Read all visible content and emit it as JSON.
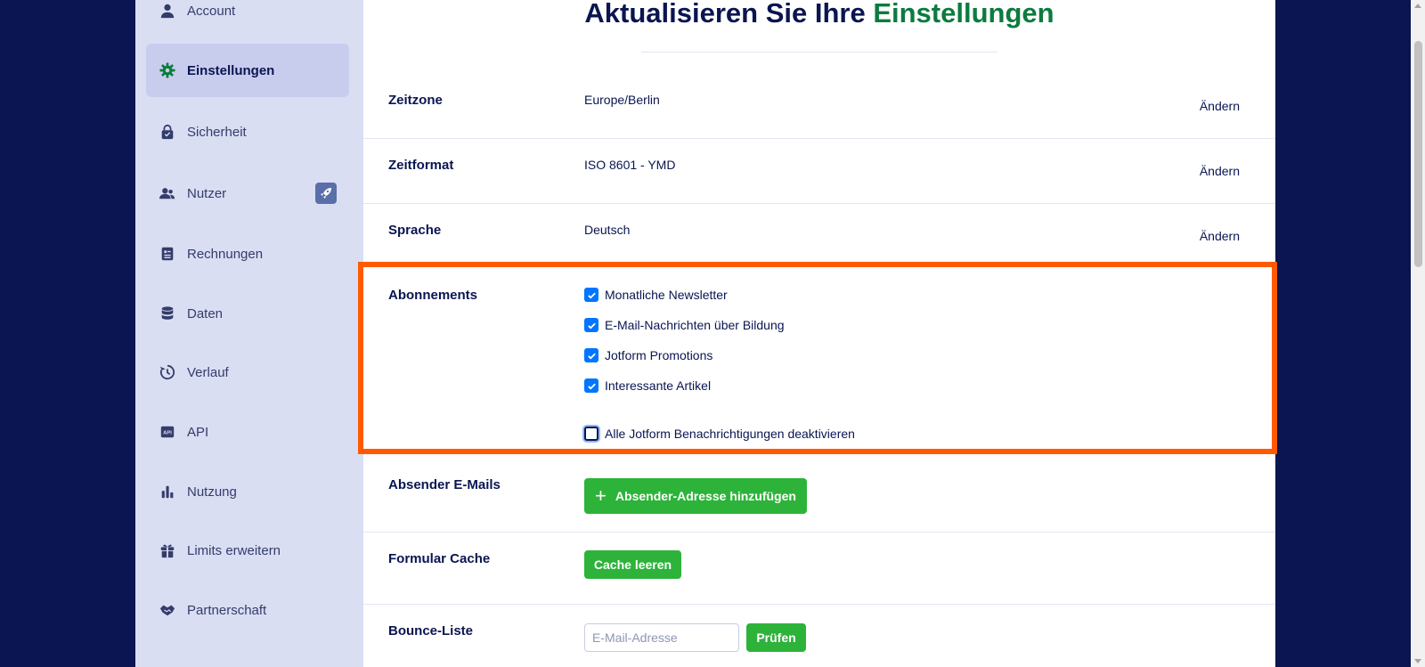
{
  "sidebar": {
    "items": [
      {
        "label": "Account",
        "icon": "user-icon"
      },
      {
        "label": "Einstellungen",
        "icon": "gear-icon",
        "active": true
      },
      {
        "label": "Sicherheit",
        "icon": "lock-icon"
      },
      {
        "label": "Nutzer",
        "icon": "users-icon",
        "badge_icon": "rocket-icon"
      },
      {
        "label": "Rechnungen",
        "icon": "invoice-icon"
      },
      {
        "label": "Daten",
        "icon": "database-icon"
      },
      {
        "label": "Verlauf",
        "icon": "history-icon"
      },
      {
        "label": "API",
        "icon": "api-icon"
      },
      {
        "label": "Nutzung",
        "icon": "bar-chart-icon"
      },
      {
        "label": "Limits erweitern",
        "icon": "gift-icon"
      },
      {
        "label": "Partnerschaft",
        "icon": "handshake-icon"
      }
    ]
  },
  "main": {
    "title_prefix": "Aktualisieren Sie Ihre ",
    "title_accent": "Einstellungen",
    "settings": [
      {
        "label": "Zeitzone",
        "value": "Europe/Berlin",
        "action": "Ändern"
      },
      {
        "label": "Zeitformat",
        "value": "ISO 8601 - YMD",
        "action": "Ändern"
      },
      {
        "label": "Sprache",
        "value": "Deutsch",
        "action": "Ändern"
      }
    ],
    "subscriptions": {
      "label": "Abonnements",
      "options": [
        {
          "label": "Monatliche Newsletter",
          "checked": true
        },
        {
          "label": "E-Mail-Nachrichten über Bildung",
          "checked": true
        },
        {
          "label": "Jotform Promotions",
          "checked": true
        },
        {
          "label": "Interessante Artikel",
          "checked": true
        }
      ],
      "disable_all": {
        "label": "Alle Jotform Benachrichtigungen deaktivieren",
        "checked": false
      }
    },
    "sender_emails": {
      "label": "Absender E-Mails",
      "button": "Absender-Adresse hinzufügen"
    },
    "form_cache": {
      "label": "Formular Cache",
      "button": "Cache leeren"
    },
    "bounce_list": {
      "label": "Bounce-Liste",
      "placeholder": "E-Mail-Adresse",
      "button": "Prüfen"
    }
  },
  "colors": {
    "background": "#0a1551",
    "sidebar": "#dadef3",
    "accent_green": "#0c7b3e",
    "button_green": "#2db33a",
    "highlight": "#ff5a00",
    "checkbox": "#0075ff"
  }
}
